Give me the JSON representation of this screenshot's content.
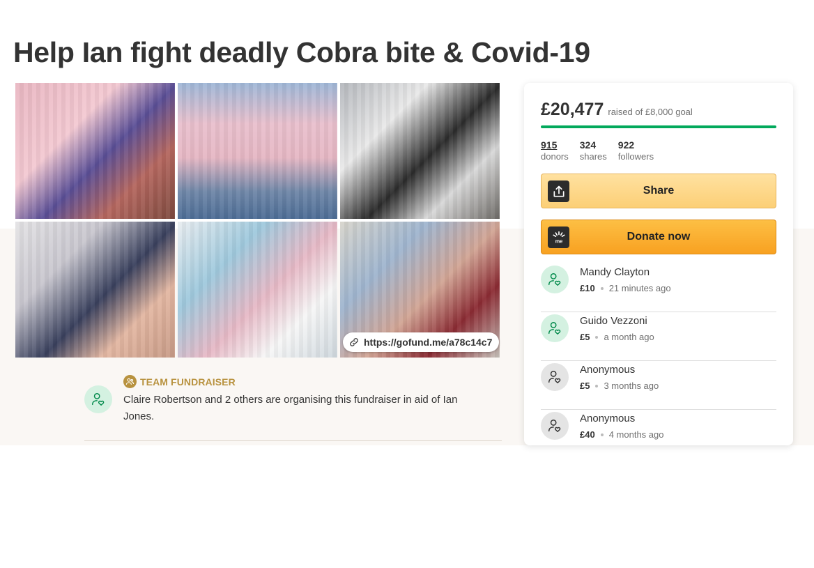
{
  "page": {
    "title": "Help Ian fight deadly Cobra bite & Covid-19"
  },
  "media": {
    "share_link": "https://gofund.me/a78c14c7"
  },
  "organiser": {
    "label": "TEAM FUNDRAISER",
    "description": "Claire Robertson and 2 others are organising this fundraiser in aid of Ian Jones."
  },
  "sidebar": {
    "raised_amount": "£20,477",
    "raised_goal_text": "raised of £8,000 goal",
    "progress_percent": 100,
    "stats": [
      {
        "value": "915",
        "label": "donors"
      },
      {
        "value": "324",
        "label": "shares"
      },
      {
        "value": "922",
        "label": "followers"
      }
    ],
    "share_label": "Share",
    "donate_label": "Donate now",
    "donations": [
      {
        "name": "Mandy Clayton",
        "amount": "£10",
        "time": "21 minutes ago"
      },
      {
        "name": "Guido Vezzoni",
        "amount": "£5",
        "time": "a month ago"
      },
      {
        "name": "Anonymous",
        "amount": "£5",
        "time": "3 months ago"
      },
      {
        "name": "Anonymous",
        "amount": "£40",
        "time": "4 months ago"
      }
    ]
  },
  "colors": {
    "accent_green": "#02a95c",
    "team_gold": "#b8923f",
    "donate_orange": "#f8a121"
  }
}
